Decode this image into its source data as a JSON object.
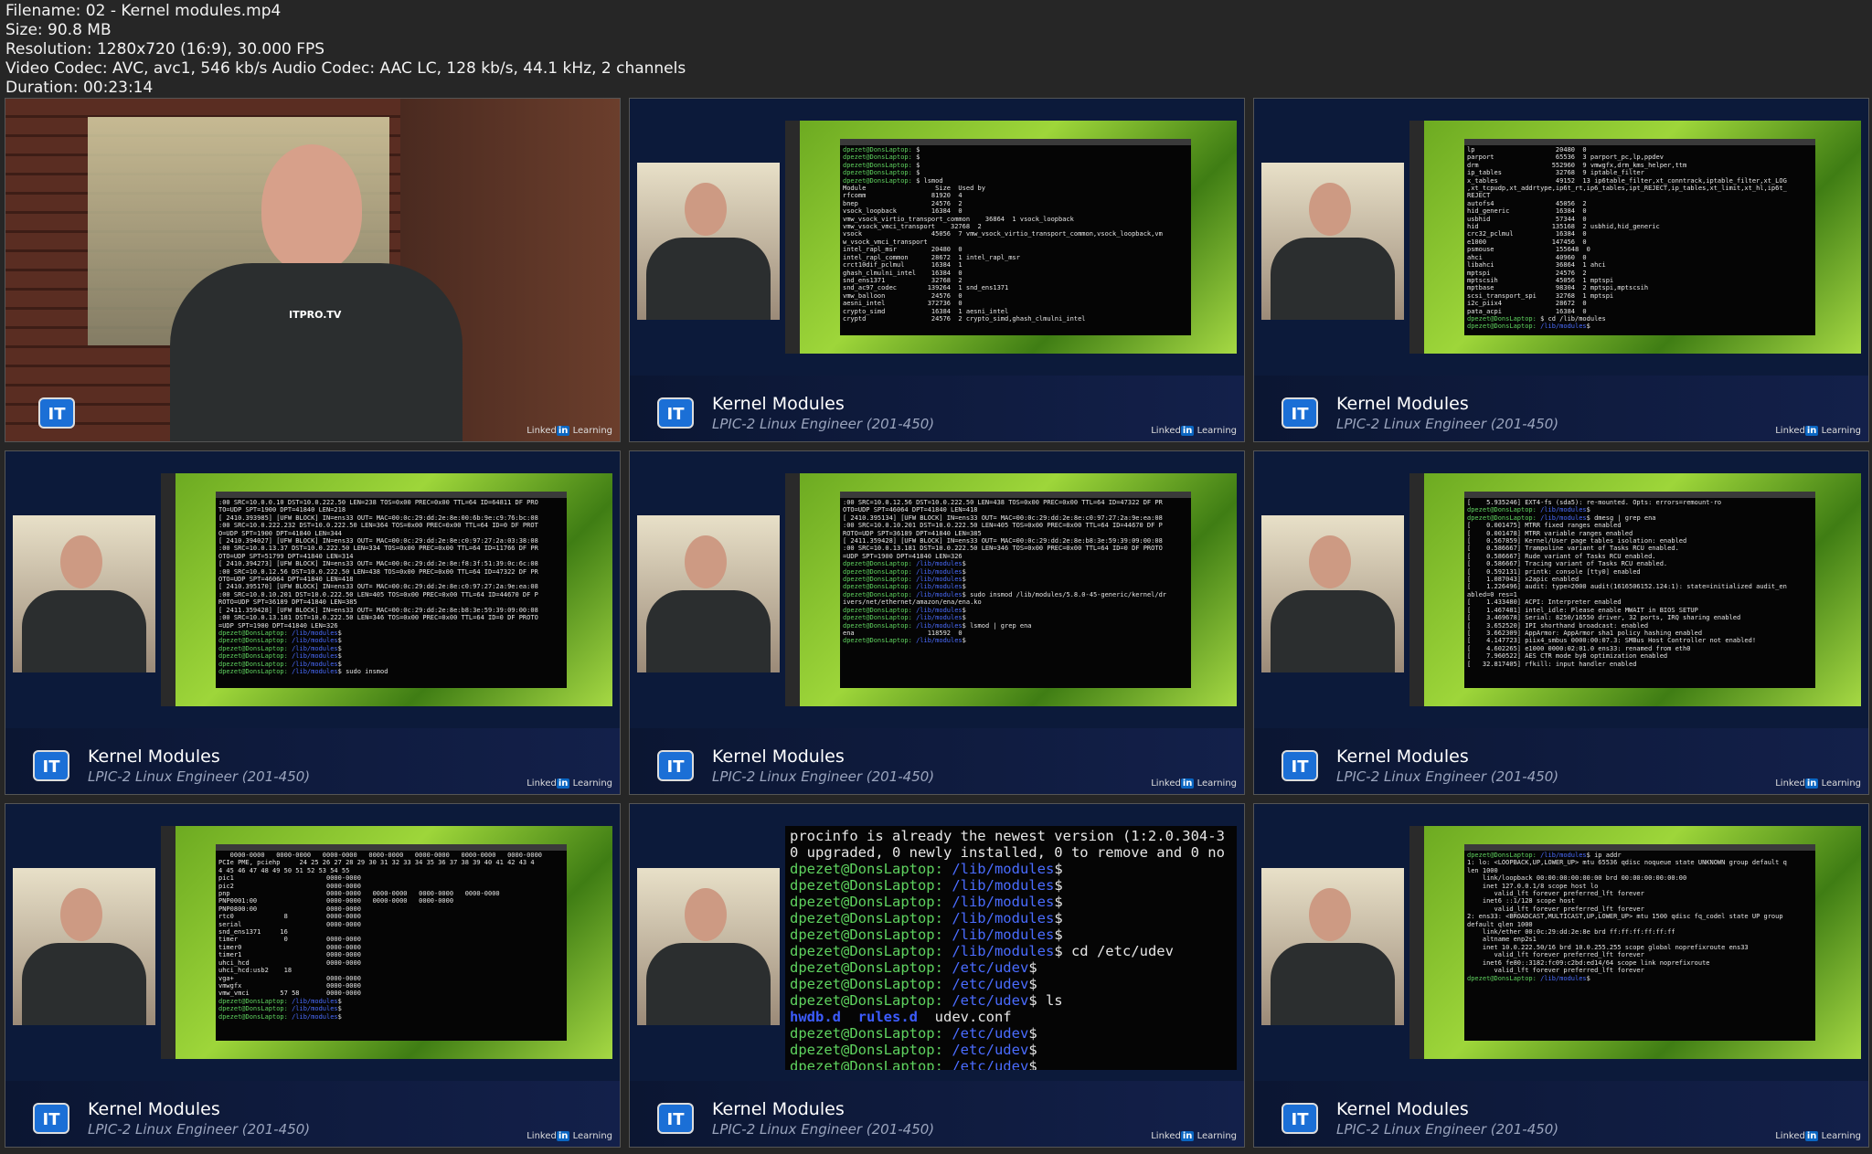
{
  "meta": {
    "filename": "Filename: 02 - Kernel modules.mp4",
    "size": "Size: 90.8 MB",
    "resolution": "Resolution: 1280x720 (16:9), 30.000 FPS",
    "codec": "Video Codec: AVC, avc1, 546 kb/s Audio Codec: AAC LC, 128 kb/s, 44.1 kHz, 2 channels",
    "duration": "Duration: 00:23:14"
  },
  "brand": {
    "badge": "IT",
    "course_title": "Kernel Modules",
    "course_sub": "LPIC-2 Linux Engineer (201-450)",
    "linkedin_pre": "Linked",
    "linkedin_in": "in",
    "linkedin_post": " Learning",
    "shirt_logo": "ITPRO.TV"
  },
  "tiles": [
    {
      "type": "presenter"
    },
    {
      "type": "terminal",
      "lines": [
        "dpezet@DonsLaptop: $",
        "dpezet@DonsLaptop: $",
        "dpezet@DonsLaptop: $",
        "dpezet@DonsLaptop: $",
        "dpezet@DonsLaptop: $ lsmod",
        "Module                  Size  Used by",
        "rfcomm                 81920  4",
        "bnep                   24576  2",
        "vsock_loopback         16384  0",
        "vmw_vsock_virtio_transport_common    36864  1 vsock_loopback",
        "vmw_vsock_vmci_transport    32768  2",
        "vsock                  45056  7 vmw_vsock_virtio_transport_common,vsock_loopback,vm",
        "w_vsock_vmci_transport",
        "intel_rapl_msr         20480  0",
        "intel_rapl_common      28672  1 intel_rapl_msr",
        "crct10dif_pclmul       16384  1",
        "ghash_clmulni_intel    16384  0",
        "snd_ens1371            32768  2",
        "snd_ac97_codec        139264  1 snd_ens1371",
        "vmw_balloon            24576  0",
        "aesni_intel           372736  0",
        "crypto_simd            16384  1 aesni_intel",
        "cryptd                 24576  2 crypto_simd,ghash_clmulni_intel"
      ]
    },
    {
      "type": "terminal",
      "lines": [
        "lp                     20480  0",
        "parport                65536  3 parport_pc,lp,ppdev",
        "drm                   552960  9 vmwgfx,drm_kms_helper,ttm",
        "ip_tables              32768  9 iptable_filter",
        "x_tables               49152  13 ip6table_filter,xt_conntrack,iptable_filter,xt_LOG",
        ",xt_tcpudp,xt_addrtype,ip6t_rt,ip6_tables,ipt_REJECT,ip_tables,xt_limit,xt_hl,ip6t_",
        "REJECT",
        "autofs4                45056  2",
        "hid_generic            16384  0",
        "usbhid                 57344  0",
        "hid                   135168  2 usbhid,hid_generic",
        "crc32_pclmul           16384  0",
        "e1000                 147456  0",
        "psmouse                155648  0",
        "ahci                   40960  0",
        "libahci                36864  1 ahci",
        "mptspi                 24576  2",
        "mptscsih               45056  1 mptspi",
        "mptbase                98304  2 mptspi,mptscsih",
        "scsi_transport_spi     32768  1 mptspi",
        "i2c_piix4              28672  0",
        "pata_acpi              16384  0",
        "dpezet@DonsLaptop: $ cd /lib/modules",
        "dpezet@DonsLaptop: /lib/modules$"
      ]
    },
    {
      "type": "terminal",
      "lines": [
        ":00 SRC=10.0.0.10 DST=10.0.222.50 LEN=238 TOS=0x00 PREC=0x00 TTL=64 ID=64811 DF PRO",
        "TO=UDP SPT=1900 DPT=41840 LEN=218",
        "[ 2410.393985] [UFW BLOCK] IN=ens33 OUT= MAC=00:0c:29:dd:2e:8e:00:6b:9e:c9:76:bc:08",
        ":00 SRC=10.0.222.232 DST=10.0.222.50 LEN=364 TOS=0x00 PREC=0x00 TTL=64 ID=0 DF PROT",
        "O=UDP SPT=1900 DPT=41840 LEN=344",
        "[ 2410.394027] [UFW BLOCK] IN=ens33 OUT= MAC=00:0c:29:dd:2e:8e:c0:97:27:2a:03:38:08",
        ":00 SRC=10.0.13.37 DST=10.0.222.50 LEN=334 TOS=0x00 PREC=0x00 TTL=64 ID=11766 DF PR",
        "OTO=UDP SPT=51799 DPT=41840 LEN=314",
        "[ 2410.394273] [UFW BLOCK] IN=ens33 OUT= MAC=00:0c:29:dd:2e:8e:f8:3f:51:39:0c:6c:08",
        ":00 SRC=10.0.12.56 DST=10.0.222.50 LEN=438 TOS=0x00 PREC=0x00 TTL=64 ID=47322 DF PR",
        "OTO=UDP SPT=46064 DPT=41840 LEN=418",
        "[ 2410.395170] [UFW BLOCK] IN=ens33 OUT= MAC=00:0c:29:dd:2e:8e:c0:97:27:2a:9e:ea:08",
        ":00 SRC=10.0.10.201 DST=10.0.222.50 LEN=405 TOS=0x00 PREC=0x00 TTL=64 ID=44670 DF P",
        "ROTO=UDP SPT=36189 DPT=41840 LEN=385",
        "[ 2411.359428] [UFW BLOCK] IN=ens33 OUT= MAC=00:0c:29:dd:2e:8e:b8:3e:59:39:09:00:08",
        ":00 SRC=10.0.13.181 DST=10.0.222.50 LEN=346 TOS=0x00 PREC=0x00 TTL=64 ID=0 DF PROTO",
        "=UDP SPT=1900 DPT=41840 LEN=326",
        "dpezet@DonsLaptop: /lib/modules$",
        "dpezet@DonsLaptop: /lib/modules$",
        "dpezet@DonsLaptop: /lib/modules$",
        "dpezet@DonsLaptop: /lib/modules$",
        "dpezet@DonsLaptop: /lib/modules$",
        "dpezet@DonsLaptop: /lib/modules$ sudo insmod"
      ]
    },
    {
      "type": "terminal",
      "lines": [
        ":00 SRC=10.0.12.56 DST=10.0.222.50 LEN=438 TOS=0x00 PREC=0x00 TTL=64 ID=47322 DF PR",
        "OTO=UDP SPT=46064 DPT=41840 LEN=418",
        "[ 2410.395134] [UFW BLOCK] IN=ens33 OUT= MAC=00:0c:29:dd:2e:8e:c0:97:27:2a:9e:ea:08",
        ":00 SRC=10.0.10.201 DST=10.0.222.50 LEN=405 TOS=0x00 PREC=0x00 TTL=64 ID=44670 DF P",
        "ROTO=UDP SPT=36189 DPT=41840 LEN=385",
        "[ 2411.359428] [UFW BLOCK] IN=ens33 OUT= MAC=00:0c:29:dd:2e:8e:b8:3e:59:39:09:00:08",
        ":00 SRC=10.0.13.181 DST=10.0.222.50 LEN=346 TOS=0x00 PREC=0x00 TTL=64 ID=0 DF PROTO",
        "=UDP SPT=1900 DPT=41840 LEN=326",
        "dpezet@DonsLaptop: /lib/modules$",
        "dpezet@DonsLaptop: /lib/modules$",
        "dpezet@DonsLaptop: /lib/modules$",
        "dpezet@DonsLaptop: /lib/modules$",
        "dpezet@DonsLaptop: /lib/modules$ sudo insmod /lib/modules/5.8.0-45-generic/kernel/dr",
        "ivers/net/ethernet/amazon/ena/ena.ko",
        "dpezet@DonsLaptop: /lib/modules$",
        "dpezet@DonsLaptop: /lib/modules$",
        "dpezet@DonsLaptop: /lib/modules$ lsmod | grep ena",
        "ena                   118592  0",
        "dpezet@DonsLaptop: /lib/modules$"
      ]
    },
    {
      "type": "terminal",
      "lines": [
        "[    5.935246] EXT4-fs (sda5): re-mounted. Opts: errors=remount-ro",
        "dpezet@DonsLaptop: /lib/modules$",
        "dpezet@DonsLaptop: /lib/modules$ dmesg | grep ena",
        "[    0.001475] MTRR fixed ranges enabled",
        "[    0.001478] MTRR variable ranges enabled",
        "[    0.567859] Kernel/User page tables isolation: enabled",
        "[    0.586667] Trampoline variant of Tasks RCU enabled.",
        "[    0.586667] Rude variant of Tasks RCU enabled.",
        "[    0.586667] Tracing variant of Tasks RCU enabled.",
        "[    0.592131] printk: console [tty0] enabled",
        "[    1.087043] x2apic enabled",
        "[    1.226496] audit: type=2000 audit(1616506152.124:1): state=initialized audit_en",
        "abled=0 res=1",
        "[    1.433480] ACPI: Interpreter enabled",
        "[    1.467481] intel_idle: Please enable MWAIT in BIOS SETUP",
        "[    3.469678] Serial: 8250/16550 driver, 32 ports, IRQ sharing enabled",
        "[    3.652520] IPI shorthand broadcast: enabled",
        "[    3.662309] AppArmor: AppArmor sha1 policy hashing enabled",
        "[    4.147723] piix4_smbus 0000:00:07.3: SMBus Host Controller not enabled!",
        "[    4.602265] e1000 0000:02:01.0 ens33: renamed from eth0",
        "[    7.960522] AES CTR mode by8 optimization enabled",
        "[   32.817405] rfkill: input handler enabled"
      ]
    },
    {
      "type": "terminal",
      "lines": [
        "   0000-0000   0000-0000   0000-0000   0000-0000   0000-0000   0000-0000   0000-0000",
        "PCIe PME, pciehp     24 25 26 27 28 29 30 31 32 33 34 35 36 37 38 39 40 41 42 43 4",
        "4 45 46 47 48 49 50 51 52 53 54 55",
        "pic1                        0000-0000",
        "pic2                        0000-0000",
        "pnp                         0000-0000   0000-0000   0000-0000   0000-0000",
        "PNP0001:00                  0000-0000   0000-0000   0000-0000",
        "PNP0800:00                  0000-0000",
        "rtc0             8          0000-0000",
        "serial                      0000-0000",
        "snd_ens1371     16",
        "timer            0          0000-0000",
        "timer0                      0000-0000",
        "timer1                      0000-0000",
        "uhci_hcd                    0000-0000",
        "uhci_hcd:usb2    18",
        "vga+                        0000-0000",
        "vmwgfx                      0000-0000",
        "vmw_vmci        57 58       0000-0000",
        "dpezet@DonsLaptop: /lib/modules$",
        "dpezet@DonsLaptop: /lib/modules$",
        "dpezet@DonsLaptop: /lib/modules$"
      ]
    },
    {
      "type": "bigterm",
      "lines": [
        "procinfo is already the newest version (1:2.0.304-3",
        "0 upgraded, 0 newly installed, 0 to remove and 0 no",
        "dpezet@DonsLaptop: /lib/modules$",
        "dpezet@DonsLaptop: /lib/modules$",
        "dpezet@DonsLaptop: /lib/modules$",
        "dpezet@DonsLaptop: /lib/modules$",
        "dpezet@DonsLaptop: /lib/modules$",
        "dpezet@DonsLaptop: /lib/modules$ cd /etc/udev",
        "dpezet@DonsLaptop: /etc/udev$",
        "dpezet@DonsLaptop: /etc/udev$",
        "dpezet@DonsLaptop: /etc/udev$ ls",
        "hwdb.d  rules.d  udev.conf",
        "dpezet@DonsLaptop: /etc/udev$",
        "dpezet@DonsLaptop: /etc/udev$",
        "dpezet@DonsLaptop: /etc/udev$"
      ]
    },
    {
      "type": "terminal",
      "lines": [
        "dpezet@DonsLaptop: /lib/modules$ ip addr",
        "1: lo: <LOOPBACK,UP,LOWER_UP> mtu 65536 qdisc noqueue state UNKNOWN group default q",
        "len 1000",
        "    link/loopback 00:00:00:00:00:00 brd 00:00:00:00:00:00",
        "    inet 127.0.0.1/8 scope host lo",
        "       valid_lft forever preferred_lft forever",
        "    inet6 ::1/128 scope host",
        "       valid_lft forever preferred_lft forever",
        "2: ens33: <BROADCAST,MULTICAST,UP,LOWER_UP> mtu 1500 qdisc fq_codel state UP group",
        "default qlen 1000",
        "    link/ether 00:0c:29:dd:2e:8e brd ff:ff:ff:ff:ff:ff",
        "    altname enp2s1",
        "    inet 10.0.222.50/16 brd 10.0.255.255 scope global noprefixroute ens33",
        "       valid_lft forever preferred_lft forever",
        "    inet6 fe80::3182:fc09:c2bd:ed14/64 scope link noprefixroute",
        "       valid_lft forever preferred_lft forever",
        "dpezet@DonsLaptop: /lib/modules$"
      ]
    }
  ]
}
